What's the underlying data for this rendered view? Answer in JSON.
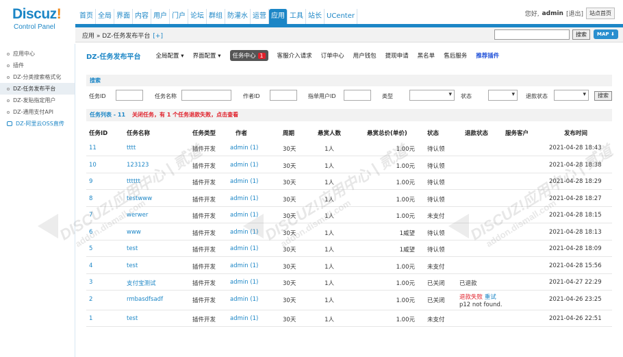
{
  "logo": {
    "brand_main": "Discuz",
    "brand_mark": "!",
    "subtitle": "Control Panel"
  },
  "topnav": [
    "首页",
    "全局",
    "界面",
    "内容",
    "用户",
    "门户",
    "论坛",
    "群组",
    "防灌水",
    "运营",
    "应用",
    "工具",
    "站长",
    "UCenter"
  ],
  "topnav_active": "应用",
  "user": {
    "greeting": "您好,",
    "name": "admin",
    "logout": "[退出]",
    "home_button": "站点首页"
  },
  "breadcrumb": {
    "text": "应用 » DZ-任务发布平台",
    "plus": "[+]"
  },
  "search": {
    "value": "",
    "button": "搜索"
  },
  "map_button": "MAP ⬇",
  "sidebar": [
    {
      "label": "应用中心",
      "icon": "dot"
    },
    {
      "label": "插件",
      "icon": "dot"
    },
    {
      "label": "DZ-分类搜索格式化",
      "icon": "dot"
    },
    {
      "label": "DZ-任务发布平台",
      "icon": "dot",
      "active": true
    },
    {
      "label": "DZ-发贴指定用户",
      "icon": "dot"
    },
    {
      "label": "DZ-通用支付API",
      "icon": "dot"
    },
    {
      "label": "DZ-阿里云OSS直传",
      "icon": "cloud"
    }
  ],
  "page_title": "DZ-任务发布平台",
  "subnav": [
    {
      "label": "全局配置 ▾"
    },
    {
      "label": "界面配置 ▾"
    },
    {
      "label": "任务中心",
      "badge": "1",
      "current": true
    },
    {
      "label": "客服介入请求"
    },
    {
      "label": "订单中心"
    },
    {
      "label": "用户钱包"
    },
    {
      "label": "提现申请"
    },
    {
      "label": "黑名单"
    },
    {
      "label": "售后服务"
    },
    {
      "label": "推荐插件",
      "rec": true
    }
  ],
  "search_section_title": "搜索",
  "filters": {
    "task_id": "任务ID",
    "task_name": "任务名称",
    "author_id": "作者ID",
    "assigned_user_id": "指单用户ID",
    "type": "类型",
    "status": "状态",
    "refund_status": "退款状态",
    "button": "搜索"
  },
  "list": {
    "title": "任务列表 - 11",
    "warning": "关闭任务，有 1 个任务退款失败，点击查看"
  },
  "columns": [
    "任务ID",
    "任务名称",
    "任务类型",
    "作者",
    "周期",
    "悬赏人数",
    "悬赏总价(单价)",
    "状态",
    "退款状态",
    "服务客户",
    "发布时间"
  ],
  "rows": [
    {
      "id": "11",
      "name": "tttt",
      "type": "插件开发",
      "author": "admin (1)",
      "period": "30天",
      "count": "1人",
      "price": "1.00元",
      "status": "待认领",
      "refund": "",
      "client": "",
      "time": "2021-04-28 18:43"
    },
    {
      "id": "10",
      "name": "123123",
      "type": "插件开发",
      "author": "admin (1)",
      "period": "30天",
      "count": "1人",
      "price": "1.00元",
      "status": "待认领",
      "refund": "",
      "client": "",
      "time": "2021-04-28 18:38"
    },
    {
      "id": "9",
      "name": "tttttt",
      "type": "插件开发",
      "author": "admin (1)",
      "period": "30天",
      "count": "1人",
      "price": "1.00元",
      "status": "待认领",
      "refund": "",
      "client": "",
      "time": "2021-04-28 18:29"
    },
    {
      "id": "8",
      "name": "testwww",
      "type": "插件开发",
      "author": "admin (1)",
      "period": "30天",
      "count": "1人",
      "price": "1.00元",
      "status": "待认领",
      "refund": "",
      "client": "",
      "time": "2021-04-28 18:27"
    },
    {
      "id": "7",
      "name": "werwer",
      "type": "插件开发",
      "author": "admin (1)",
      "period": "30天",
      "count": "1人",
      "price": "1.00元",
      "status": "未支付",
      "refund": "",
      "client": "",
      "time": "2021-04-28 18:15"
    },
    {
      "id": "6",
      "name": "www",
      "type": "插件开发",
      "author": "admin (1)",
      "period": "30天",
      "count": "1人",
      "price": "1威望",
      "status": "待认领",
      "refund": "",
      "client": "",
      "time": "2021-04-28 18:13"
    },
    {
      "id": "5",
      "name": "test",
      "type": "插件开发",
      "author": "admin (1)",
      "period": "30天",
      "count": "1人",
      "price": "1威望",
      "status": "待认领",
      "refund": "",
      "client": "",
      "time": "2021-04-28 18:09"
    },
    {
      "id": "4",
      "name": "test",
      "type": "插件开发",
      "author": "admin (1)",
      "period": "30天",
      "count": "1人",
      "price": "1.00元",
      "status": "未支付",
      "refund": "",
      "client": "",
      "time": "2021-04-28 15:56"
    },
    {
      "id": "3",
      "name": "支付宝测试",
      "type": "插件开发",
      "author": "admin (1)",
      "period": "30天",
      "count": "1人",
      "price": "1.00元",
      "status": "已关闭",
      "refund": "已退款",
      "client": "",
      "time": "2021-04-27 22:29"
    },
    {
      "id": "2",
      "name": "rmbasdfsadf",
      "type": "插件开发",
      "author": "admin (1)",
      "period": "30天",
      "count": "1人",
      "price": "1.00元",
      "status": "已关闭",
      "refund_fail": "退款失败",
      "refund_retry": "重试",
      "refund_note": "p12 not found.",
      "client": "",
      "time": "2021-04-26 23:25"
    },
    {
      "id": "1",
      "name": "test",
      "type": "插件开发",
      "author": "admin (1)",
      "period": "30天",
      "count": "1人",
      "price": "1.00元",
      "status": "未支付",
      "refund": "",
      "client": "",
      "time": "2021-04-26 22:51"
    }
  ],
  "watermark": {
    "line1": "DISCUZ!应用中心 | 贰道",
    "line2": "addon.dismall.com"
  }
}
